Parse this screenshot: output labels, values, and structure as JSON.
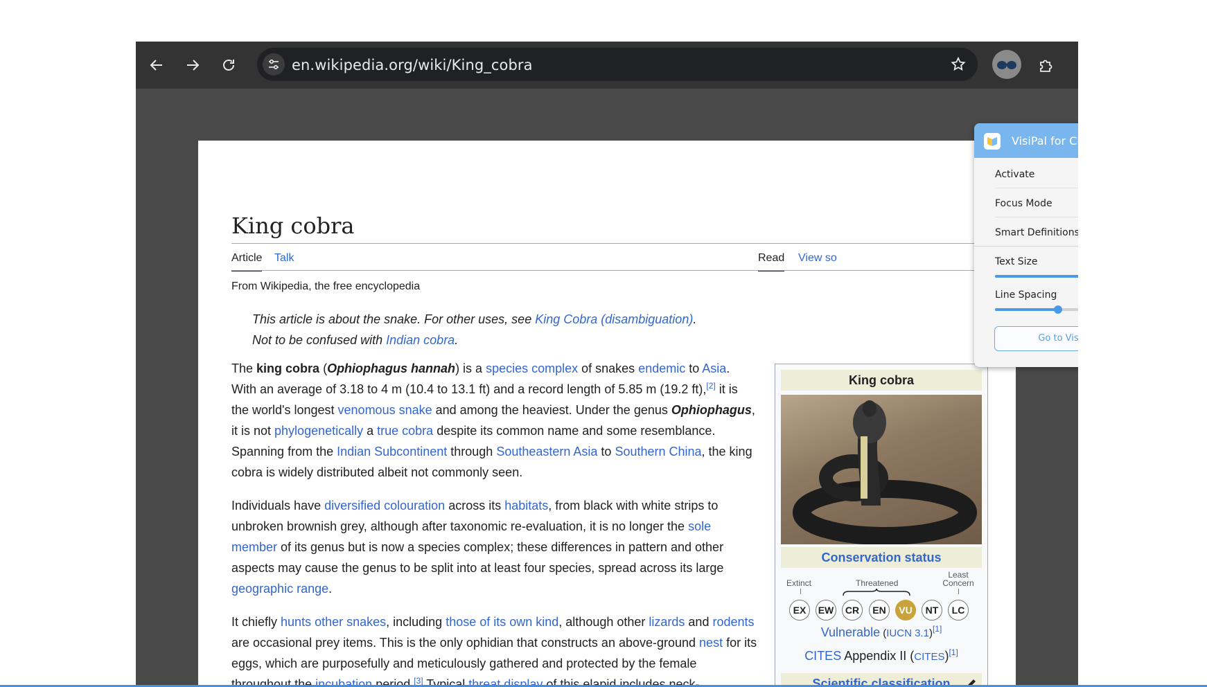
{
  "browser": {
    "url": "en.wikipedia.org/wiki/King_cobra"
  },
  "article": {
    "title": "King cobra",
    "tabs": {
      "article": "Article",
      "talk": "Talk",
      "read": "Read",
      "view_source": "View so"
    },
    "from": "From Wikipedia, the free encyclopedia",
    "hatnote1": {
      "pre": "This article is about the snake. For other uses, see ",
      "link": "King Cobra (disambiguation)",
      "post": "."
    },
    "hatnote2": {
      "pre": "Not to be confused with ",
      "link": "Indian cobra",
      "post": "."
    },
    "p1": [
      {
        "t": "The "
      },
      {
        "t": "king cobra",
        "b": true
      },
      {
        "t": " ("
      },
      {
        "t": "Ophiophagus hannah",
        "b": true,
        "i": true
      },
      {
        "t": ") is a "
      },
      {
        "t": "species complex",
        "l": true
      },
      {
        "t": " of snakes "
      },
      {
        "t": "endemic",
        "l": true
      },
      {
        "t": " to "
      },
      {
        "t": "Asia",
        "l": true
      },
      {
        "t": ". With an average of 3.18 to 4 m (10.4 to 13.1 ft) and a record length of 5.85 m (19.2 ft),"
      },
      {
        "t": "[2]",
        "l": true,
        "sup": true
      },
      {
        "t": " it is the world's longest "
      },
      {
        "t": "venomous snake",
        "l": true
      },
      {
        "t": " and among the heaviest. Under the genus "
      },
      {
        "t": "Ophiophagus",
        "b": true,
        "i": true
      },
      {
        "t": ", it is not "
      },
      {
        "t": "phylogenetically",
        "l": true
      },
      {
        "t": " a "
      },
      {
        "t": "true cobra",
        "l": true
      },
      {
        "t": " despite its common name and some resemblance. Spanning from the "
      },
      {
        "t": "Indian Subcontinent",
        "l": true
      },
      {
        "t": " through "
      },
      {
        "t": "Southeastern Asia",
        "l": true
      },
      {
        "t": " to "
      },
      {
        "t": "Southern China",
        "l": true
      },
      {
        "t": ", the king cobra is widely distributed albeit not commonly seen."
      }
    ],
    "p2": [
      {
        "t": "Individuals have "
      },
      {
        "t": "diversified colouration",
        "l": true
      },
      {
        "t": " across its "
      },
      {
        "t": "habitats",
        "l": true
      },
      {
        "t": ", from black with white strips to unbroken brownish grey, although after taxonomic re-evaluation, it is no longer the "
      },
      {
        "t": "sole member",
        "l": true
      },
      {
        "t": " of its genus but is now a species complex; these differences in pattern and other aspects may cause the genus to be split into at least four species, spread across its large "
      },
      {
        "t": "geographic range",
        "l": true
      },
      {
        "t": "."
      }
    ],
    "p3": [
      {
        "t": "It chiefly "
      },
      {
        "t": "hunts other snakes",
        "l": true
      },
      {
        "t": ", including "
      },
      {
        "t": "those of its own kind",
        "l": true
      },
      {
        "t": ", although other "
      },
      {
        "t": "lizards",
        "l": true
      },
      {
        "t": " and "
      },
      {
        "t": "rodents",
        "l": true
      },
      {
        "t": " are occasional prey items. This is the only ophidian that constructs an above-ground "
      },
      {
        "t": "nest",
        "l": true
      },
      {
        "t": " for its eggs, which are purposefully and meticulously gathered and protected by the female throughout the "
      },
      {
        "t": "incubation",
        "l": true
      },
      {
        "t": " period."
      },
      {
        "t": "[3]",
        "l": true,
        "sup": true
      },
      {
        "t": " Typical "
      },
      {
        "t": "threat display",
        "l": true
      },
      {
        "t": " of this elapid includes neck-"
      }
    ]
  },
  "infobox": {
    "title": "King cobra",
    "conservation": "Conservation status",
    "extinct": "Extinct",
    "threatened": "Threatened",
    "least_concern_1": "Least",
    "least_concern_2": "Concern",
    "levels": [
      "EX",
      "EW",
      "CR",
      "EN",
      "VU",
      "NT",
      "LC"
    ],
    "active_level": "VU",
    "status": "Vulnerable",
    "status_ref_pre": " (",
    "iucn": "IUCN 3.1",
    "status_ref_post": ")",
    "ref1": "[1]",
    "cites": "CITES",
    "appendix": " Appendix II (",
    "cites_link": "CITES",
    "cites_post": ")",
    "sci": "Scientific classification"
  },
  "popup": {
    "title": "VisiPal for Chrome",
    "activate": "Activate",
    "focus_mode": "Focus Mode",
    "smart_definitions": "Smart Definitions",
    "text_size": "Text Size",
    "line_spacing": "Line Spacing",
    "text_size_value": 0.58,
    "line_spacing_value": 0.41,
    "goto": "Go to VisiPods"
  }
}
